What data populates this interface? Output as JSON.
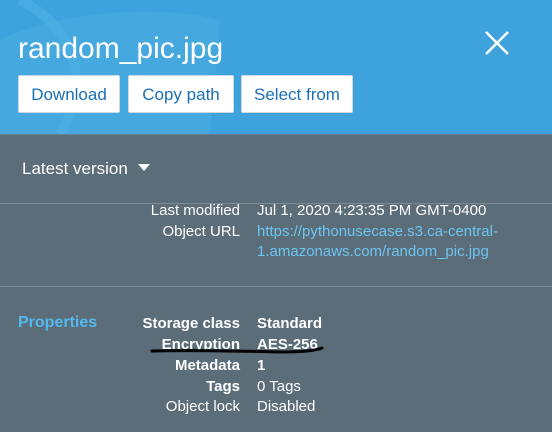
{
  "header": {
    "title": "random_pic.jpg",
    "buttons": {
      "download": "Download",
      "copy_path": "Copy path",
      "select_from": "Select from"
    }
  },
  "version_selector": {
    "label": "Latest version"
  },
  "overview": {
    "last_modified_label": "Last modified",
    "last_modified_value": "Jul 1, 2020 4:23:35 PM GMT-0400",
    "object_url_label": "Object URL",
    "object_url_line1": "https://pythonusecase.s3.ca-central-",
    "object_url_line2": "1.amazonaws.com/random_pic.jpg"
  },
  "properties": {
    "section_label": "Properties",
    "rows": [
      {
        "label": "Storage class",
        "value": "Standard"
      },
      {
        "label": "Encryption",
        "value": "AES-256"
      },
      {
        "label": "Metadata",
        "value": "1"
      },
      {
        "label": "Tags",
        "value": "0 Tags"
      },
      {
        "label": "Object lock",
        "value": "Disabled"
      }
    ]
  },
  "colors": {
    "header_bg": "#3ea3dc",
    "panel_bg": "#5b6d79",
    "link": "#6cc5f2",
    "accent": "#55b9ee"
  }
}
